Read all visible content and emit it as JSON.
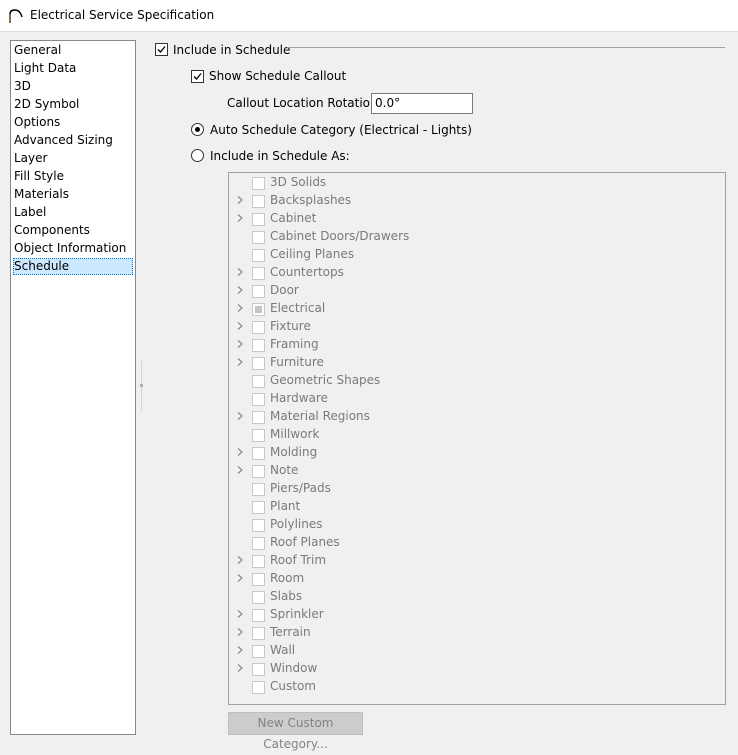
{
  "window": {
    "title": "Electrical Service Specification"
  },
  "nav": {
    "items": [
      {
        "label": "General"
      },
      {
        "label": "Light Data"
      },
      {
        "label": "3D"
      },
      {
        "label": "2D Symbol"
      },
      {
        "label": "Options"
      },
      {
        "label": "Advanced Sizing"
      },
      {
        "label": "Layer"
      },
      {
        "label": "Fill Style"
      },
      {
        "label": "Materials"
      },
      {
        "label": "Label"
      },
      {
        "label": "Components"
      },
      {
        "label": "Object Information"
      },
      {
        "label": "Schedule",
        "selected": true
      }
    ]
  },
  "schedule": {
    "include_label": "Include in Schedule",
    "include_checked": true,
    "show_callout_label": "Show Schedule Callout",
    "show_callout_checked": true,
    "rotation_label": "Callout Location Rotation:",
    "rotation_value": "0.0°",
    "auto_category_label": "Auto Schedule Category (Electrical - Lights)",
    "auto_category_selected": true,
    "include_as_label": "Include in Schedule As:",
    "include_as_selected": false,
    "categories": [
      {
        "label": "3D Solids",
        "expandable": false,
        "state": "unchecked"
      },
      {
        "label": "Backsplashes",
        "expandable": true,
        "state": "unchecked"
      },
      {
        "label": "Cabinet",
        "expandable": true,
        "state": "unchecked"
      },
      {
        "label": "Cabinet Doors/Drawers",
        "expandable": false,
        "state": "unchecked"
      },
      {
        "label": "Ceiling Planes",
        "expandable": false,
        "state": "unchecked"
      },
      {
        "label": "Countertops",
        "expandable": true,
        "state": "unchecked"
      },
      {
        "label": "Door",
        "expandable": true,
        "state": "unchecked"
      },
      {
        "label": "Electrical",
        "expandable": true,
        "state": "indeterminate"
      },
      {
        "label": "Fixture",
        "expandable": true,
        "state": "unchecked"
      },
      {
        "label": "Framing",
        "expandable": true,
        "state": "unchecked"
      },
      {
        "label": "Furniture",
        "expandable": true,
        "state": "unchecked"
      },
      {
        "label": "Geometric Shapes",
        "expandable": false,
        "state": "unchecked"
      },
      {
        "label": "Hardware",
        "expandable": false,
        "state": "unchecked"
      },
      {
        "label": "Material Regions",
        "expandable": true,
        "state": "unchecked"
      },
      {
        "label": "Millwork",
        "expandable": false,
        "state": "unchecked"
      },
      {
        "label": "Molding",
        "expandable": true,
        "state": "unchecked"
      },
      {
        "label": "Note",
        "expandable": true,
        "state": "unchecked"
      },
      {
        "label": "Piers/Pads",
        "expandable": false,
        "state": "unchecked"
      },
      {
        "label": "Plant",
        "expandable": false,
        "state": "unchecked"
      },
      {
        "label": "Polylines",
        "expandable": false,
        "state": "unchecked"
      },
      {
        "label": "Roof Planes",
        "expandable": false,
        "state": "unchecked"
      },
      {
        "label": "Roof Trim",
        "expandable": true,
        "state": "unchecked"
      },
      {
        "label": "Room",
        "expandable": true,
        "state": "unchecked"
      },
      {
        "label": "Slabs",
        "expandable": false,
        "state": "unchecked"
      },
      {
        "label": "Sprinkler",
        "expandable": true,
        "state": "unchecked"
      },
      {
        "label": "Terrain",
        "expandable": true,
        "state": "unchecked"
      },
      {
        "label": "Wall",
        "expandable": true,
        "state": "unchecked"
      },
      {
        "label": "Window",
        "expandable": true,
        "state": "unchecked"
      },
      {
        "label": "Custom",
        "expandable": false,
        "state": "unchecked"
      }
    ],
    "new_custom_button": "New Custom Category..."
  },
  "colors": {
    "selection_bg": "#cce8ff",
    "disabled_text": "#7a7a7a",
    "dialog_bg": "#f0f0f0"
  },
  "icons": {
    "title_icon": "arch-curve-icon",
    "expander": "chevron-right-icon",
    "check": "checkmark-icon"
  }
}
